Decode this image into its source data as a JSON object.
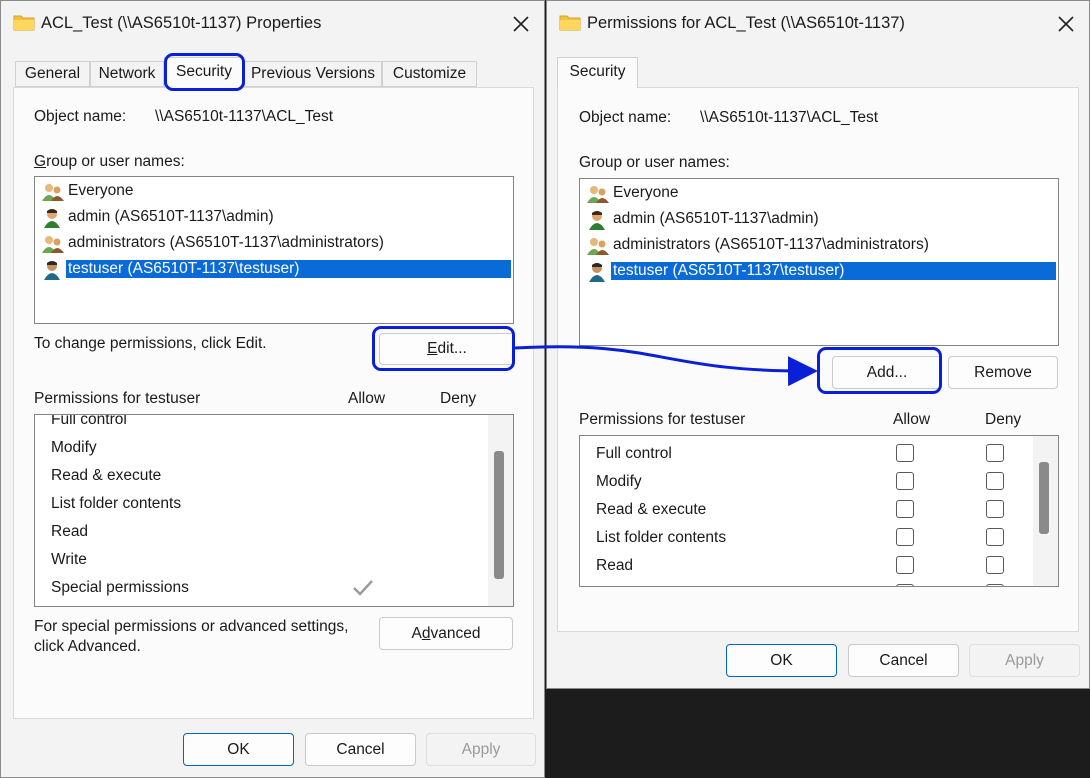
{
  "colors": {
    "highlight_outline": "#0a1fd8",
    "selection": "#0a6ad8",
    "accent": "#0067c0"
  },
  "props": {
    "title": "ACL_Test (\\\\AS6510t-1137) Properties",
    "tabs": [
      "General",
      "Network",
      "Security",
      "Previous Versions",
      "Customize"
    ],
    "active_tab": "Security",
    "object_label": "Object name:",
    "object_value": "\\\\AS6510t-1137\\ACL_Test",
    "group_label": "Group or user names:",
    "users": [
      {
        "name": "Everyone",
        "icon": "group-icon"
      },
      {
        "name": "admin (AS6510T-1137\\admin)",
        "icon": "user-icon"
      },
      {
        "name": "administrators (AS6510T-1137\\administrators)",
        "icon": "group-icon"
      },
      {
        "name": "testuser (AS6510T-1137\\testuser)",
        "icon": "user-icon",
        "selected": true
      }
    ],
    "change_text": "To change permissions, click Edit.",
    "edit_label": "Edit...",
    "perm_header": "Permissions for testuser",
    "allow_header": "Allow",
    "deny_header": "Deny",
    "permissions": [
      {
        "name": "Full control"
      },
      {
        "name": "Modify"
      },
      {
        "name": "Read & execute"
      },
      {
        "name": "List folder contents"
      },
      {
        "name": "Read"
      },
      {
        "name": "Write"
      },
      {
        "name": "Special permissions",
        "allow": true
      }
    ],
    "special_text_1": "For special permissions or advanced settings,",
    "special_text_2": "click Advanced.",
    "advanced_label": "Advanced",
    "ok": "OK",
    "cancel": "Cancel",
    "apply": "Apply"
  },
  "perms": {
    "title": "Permissions for ACL_Test (\\\\AS6510t-1137)",
    "tab": "Security",
    "object_label": "Object name:",
    "object_value": "\\\\AS6510t-1137\\ACL_Test",
    "group_label": "Group or user names:",
    "users": [
      {
        "name": "Everyone",
        "icon": "group-icon"
      },
      {
        "name": "admin (AS6510T-1137\\admin)",
        "icon": "user-icon"
      },
      {
        "name": "administrators (AS6510T-1137\\administrators)",
        "icon": "group-icon"
      },
      {
        "name": "testuser (AS6510T-1137\\testuser)",
        "icon": "user-icon",
        "selected": true
      }
    ],
    "add_label": "Add...",
    "remove_label": "Remove",
    "perm_header": "Permissions for testuser",
    "allow_header": "Allow",
    "deny_header": "Deny",
    "permissions": [
      "Full control",
      "Modify",
      "Read & execute",
      "List folder contents",
      "Read"
    ],
    "ok": "OK",
    "cancel": "Cancel",
    "apply": "Apply"
  }
}
